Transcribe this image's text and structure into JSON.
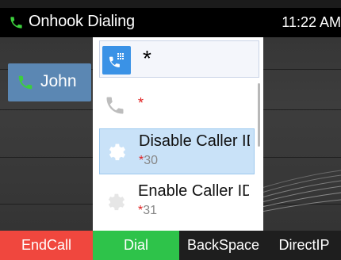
{
  "status_bar": {
    "call_icon": "phone-handset-icon",
    "title": "Onhook Dialing",
    "time": "11:22 AM",
    "colors": {
      "background": "#000000",
      "call_icon": "#3ccf3c"
    }
  },
  "line_key": {
    "label": "John",
    "icon": "phone-handset-icon",
    "color": "#5b87b3"
  },
  "dial_popup": {
    "input_icon": "dialpad-phone-icon",
    "input_value": "*",
    "items": [
      {
        "name": "",
        "code_star": "*",
        "code_number": "",
        "icon": "phone-handset-icon",
        "selected": false
      },
      {
        "name": "Disable Caller ID",
        "code_star": "*",
        "code_number": "30",
        "icon": "gear-icon",
        "selected": true
      },
      {
        "name": "Enable Caller ID",
        "code_star": "*",
        "code_number": "31",
        "icon": "gear-icon",
        "selected": false
      }
    ]
  },
  "softkeys": [
    {
      "label": "EndCall",
      "color": "#f0473e"
    },
    {
      "label": "Dial",
      "color": "#2ec34a"
    },
    {
      "label": "BackSpace",
      "color": "#1e1e1e"
    },
    {
      "label": "DirectIP",
      "color": "#1e1e1e"
    }
  ]
}
